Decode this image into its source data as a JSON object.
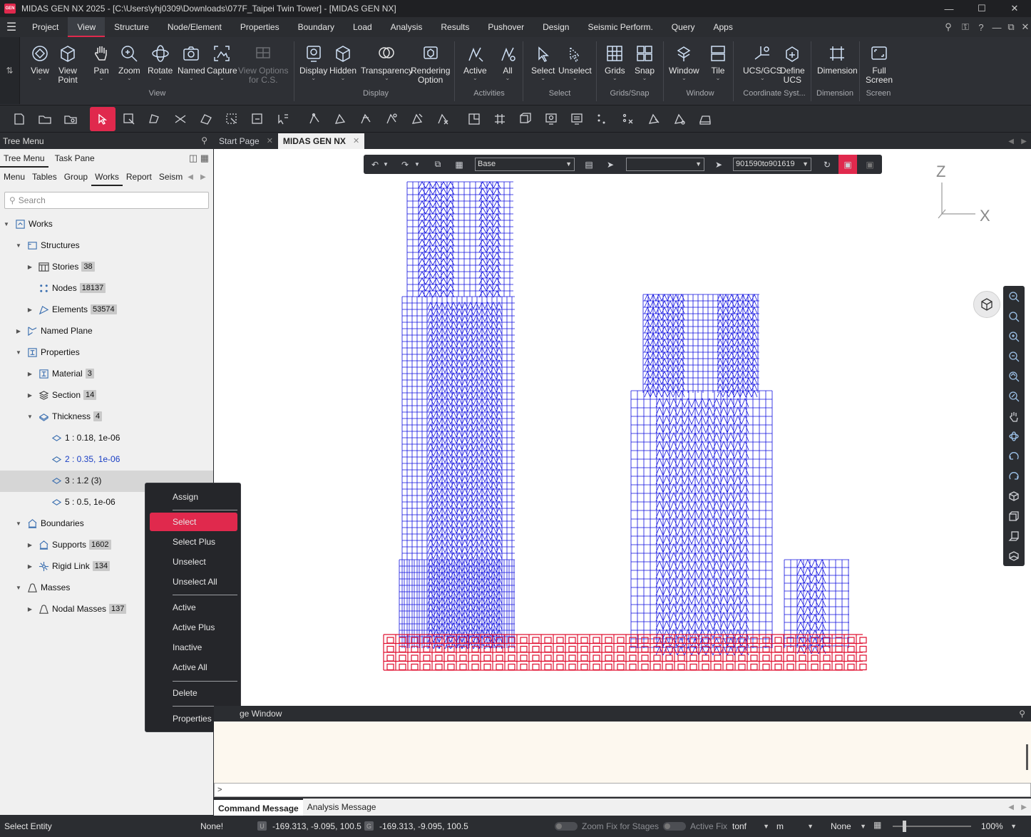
{
  "window": {
    "title": "MIDAS GEN NX 2025 - [C:\\Users\\yhj0309\\Downloads\\077F_Taipei Twin Tower] - [MIDAS GEN NX]",
    "logo_text": "GEN"
  },
  "menubar": {
    "items": [
      "Project",
      "View",
      "Structure",
      "Node/Element",
      "Properties",
      "Boundary",
      "Load",
      "Analysis",
      "Results",
      "Pushover",
      "Design",
      "Seismic Perform.",
      "Query",
      "Apps"
    ],
    "active": "View"
  },
  "ribbon": {
    "groups": {
      "view": "View",
      "display": "Display",
      "activities": "Activities",
      "select": "Select",
      "grids_snap": "Grids/Snap",
      "window": "Window",
      "coordinate": "Coordinate Syst...",
      "dimension": "Dimension",
      "screen": "Screen"
    },
    "buttons": {
      "view": "View",
      "view_point_1": "View",
      "view_point_2": "Point",
      "pan": "Pan",
      "zoom": "Zoom",
      "rotate": "Rotate",
      "named": "Named",
      "capture": "Capture",
      "view_options_1": "View Options",
      "view_options_2": "for C.S.",
      "display": "Display",
      "hidden": "Hidden",
      "transparency": "Transparency",
      "rendering_1": "Rendering",
      "rendering_2": "Option",
      "active": "Active",
      "all": "All",
      "select": "Select",
      "unselect": "Unselect",
      "grids": "Grids",
      "snap": "Snap",
      "window": "Window",
      "tile": "Tile",
      "ucs_gcs": "UCS/GCS",
      "define_ucs_1": "Define",
      "define_ucs_2": "UCS",
      "dimension": "Dimension",
      "full_screen_1": "Full",
      "full_screen_2": "Screen"
    }
  },
  "tree_panel": {
    "title": "Tree Menu",
    "top_tabs": [
      "Tree Menu",
      "Task Pane"
    ],
    "sub_tabs": [
      "Menu",
      "Tables",
      "Group",
      "Works",
      "Report",
      "Seism"
    ],
    "active_sub_tab": "Works",
    "search_placeholder": "Search",
    "rows": {
      "works": "Works",
      "structures": "Structures",
      "stories": "Stories",
      "stories_count": "38",
      "nodes": "Nodes",
      "nodes_count": "18137",
      "elements": "Elements",
      "elements_count": "53574",
      "named_plane": "Named Plane",
      "properties": "Properties",
      "material": "Material",
      "material_count": "3",
      "section": "Section",
      "section_count": "14",
      "thickness": "Thickness",
      "thickness_count": "4",
      "t1": "1 : 0.18, 1e-06",
      "t2": "2 : 0.35, 1e-06",
      "t3": "3 : 1.2 (3)",
      "t5": "5 : 0.5, 1e-06",
      "boundaries": "Boundaries",
      "supports": "Supports",
      "supports_count": "1602",
      "rigid_link": "Rigid Link",
      "rigid_link_count": "134",
      "masses": "Masses",
      "nodal_masses": "Nodal Masses",
      "nodal_masses_count": "137"
    }
  },
  "context_menu": {
    "items": {
      "assign": "Assign",
      "select": "Select",
      "select_plus": "Select Plus",
      "unselect": "Unselect",
      "unselect_all": "Unselect All",
      "active": "Active",
      "active_plus": "Active Plus",
      "inactive": "Inactive",
      "active_all": "Active All",
      "delete": "Delete",
      "properties": "Properties"
    },
    "highlighted": "Select"
  },
  "view_tabs": [
    "Start Page",
    "MIDAS GEN NX"
  ],
  "float_toolbar": {
    "base_select": "Base",
    "blank_select": "",
    "range_select": "901590to901619"
  },
  "axes": {
    "z": "Z",
    "x": "X"
  },
  "message_window": {
    "title": "ge Window",
    "prompt": ">",
    "tabs": [
      "Command Message",
      "Analysis Message"
    ]
  },
  "status_bar": {
    "mode": "Select Entity",
    "none_status": "None!",
    "ucs_badge": "U",
    "ucs_coord": "-169.313, -9.095, 100.5",
    "gcs_badge": "G",
    "gcs_coord": "-169.313, -9.095, 100.5",
    "zoom_fix": "Zoom Fix for Stages",
    "active_fix": "Active Fix",
    "force_unit": "tonf",
    "length_unit": "m",
    "none_select": "None",
    "zoom_level": "100%"
  },
  "colors": {
    "accent": "#e0294d",
    "model_lines": "#1010e0",
    "selected_lines": "#e01030"
  }
}
